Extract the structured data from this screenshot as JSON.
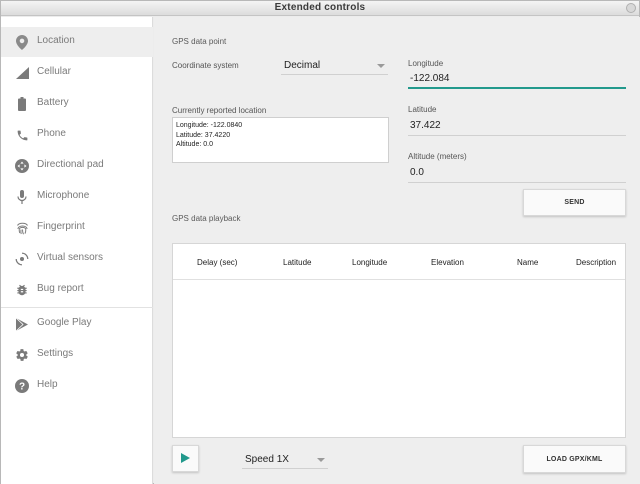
{
  "window": {
    "title": "Extended controls"
  },
  "sidebar": {
    "items": [
      {
        "label": "Location",
        "icon": "location-pin-icon"
      },
      {
        "label": "Cellular",
        "icon": "signal-icon"
      },
      {
        "label": "Battery",
        "icon": "battery-icon"
      },
      {
        "label": "Phone",
        "icon": "phone-icon"
      },
      {
        "label": "Directional pad",
        "icon": "dpad-icon"
      },
      {
        "label": "Microphone",
        "icon": "microphone-icon"
      },
      {
        "label": "Fingerprint",
        "icon": "fingerprint-icon"
      },
      {
        "label": "Virtual sensors",
        "icon": "rotate-icon"
      },
      {
        "label": "Bug report",
        "icon": "bug-icon"
      },
      {
        "label": "Google Play",
        "icon": "play-store-icon"
      },
      {
        "label": "Settings",
        "icon": "gear-icon"
      },
      {
        "label": "Help",
        "icon": "help-icon"
      }
    ]
  },
  "gps": {
    "section_title": "GPS data point",
    "coordinate_label": "Coordinate system",
    "coordinate_value": "Decimal",
    "longitude_label": "Longitude",
    "longitude_value": "-122.084",
    "latitude_label": "Latitude",
    "latitude_value": "37.422",
    "altitude_label": "Altitude (meters)",
    "altitude_value": "0.0",
    "reported_label": "Currently reported location",
    "reported_lines": [
      "Longitude: -122.0840",
      "Latitude: 37.4220",
      "Altitude: 0.0"
    ],
    "send_label": "SEND"
  },
  "playback": {
    "section_title": "GPS data playback",
    "columns": [
      "Delay (sec)",
      "Latitude",
      "Longitude",
      "Elevation",
      "Name",
      "Description"
    ],
    "speed_value": "Speed 1X",
    "load_label": "LOAD GPX/KML"
  },
  "colors": {
    "accent": "#22998c",
    "icon_gray": "#7a7a7a",
    "location_icon": "#8a8a8a"
  }
}
